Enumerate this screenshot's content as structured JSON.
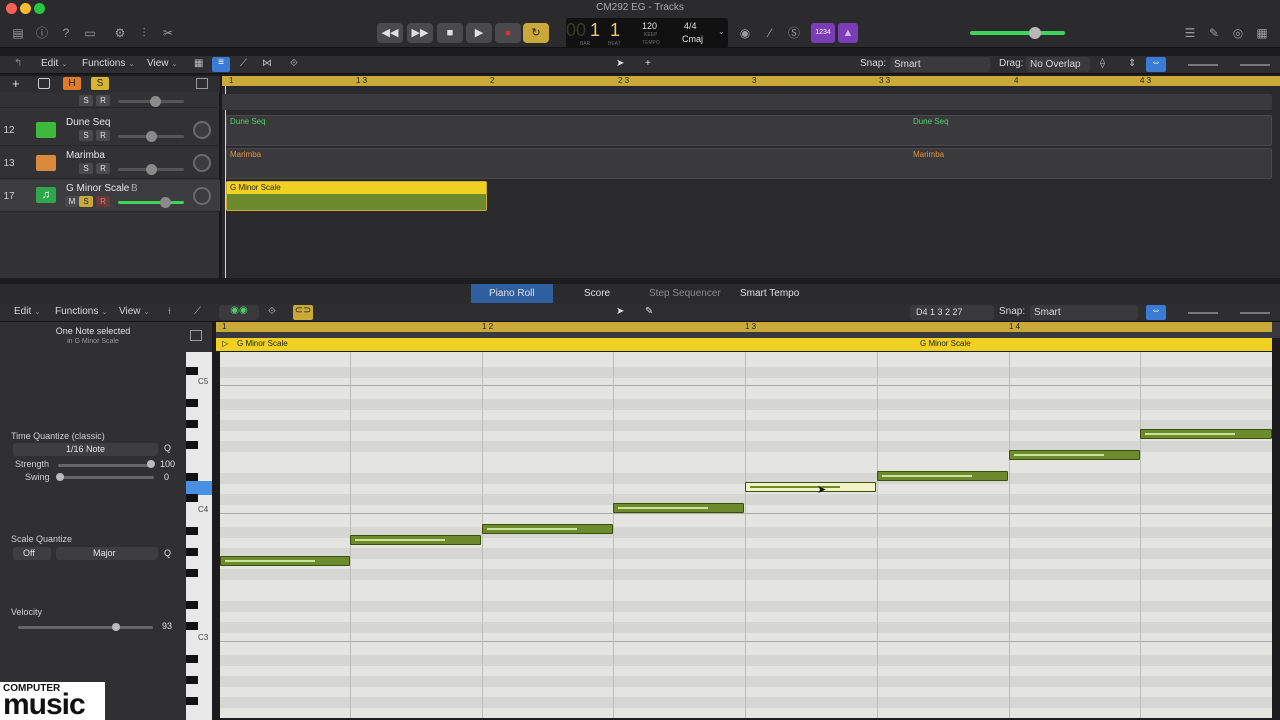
{
  "window": {
    "title": "CM292 EG - Tracks"
  },
  "transport": {
    "bar": "1",
    "beat": "1",
    "bar_prefix": "00",
    "bar_label": "BAR",
    "beat_label": "BEAT",
    "tempo": "120",
    "tempo_sub": "KEEP",
    "tempo_label": "TEMPO",
    "time_signature": "4/4",
    "key": "Cmaj",
    "count_in": "1234"
  },
  "tracks_toolbar": {
    "edit": "Edit",
    "functions": "Functions",
    "view": "View",
    "snap_label": "Snap:",
    "snap_value": "Smart",
    "drag_label": "Drag:",
    "drag_value": "No Overlap",
    "h_button": "H",
    "s_button": "S"
  },
  "ruler": {
    "marks": [
      "1",
      "1 3",
      "2",
      "2 3",
      "3",
      "3 3",
      "4",
      "4 3"
    ]
  },
  "tracks": [
    {
      "num": "12",
      "name": "Dune Seq",
      "color": "#3dba3a"
    },
    {
      "num": "13",
      "name": "Marimba",
      "color": "#d98a3a"
    },
    {
      "num": "17",
      "name": "G Minor Scale",
      "color": "#2fa84c",
      "suffix": "B"
    }
  ],
  "buttons": {
    "mute": "M",
    "solo": "S",
    "rec": "R"
  },
  "regions": {
    "dune1": "Dune Seq",
    "dune2": "Dune Seq",
    "marimba1": "Marimba",
    "marimba2": "Marimba",
    "gminor": "G Minor Scale"
  },
  "pr_tabs": [
    "Piano Roll",
    "Score",
    "Step Sequencer",
    "Smart Tempo"
  ],
  "pr_toolbar": {
    "edit": "Edit",
    "functions": "Functions",
    "view": "View",
    "position": "D4   1 3 2 27",
    "snap_label": "Snap:",
    "snap_value": "Smart"
  },
  "inspector": {
    "selection": "One Note selected",
    "selection_sub": "in G Minor Scale",
    "time_quantize_label": "Time Quantize (classic)",
    "time_quantize_value": "1/16 Note",
    "q": "Q",
    "strength_label": "Strength",
    "strength_value": "100",
    "swing_label": "Swing",
    "swing_value": "0",
    "scale_quantize_label": "Scale Quantize",
    "scale_off": "Off",
    "scale_type": "Major",
    "velocity_label": "Velocity",
    "velocity_value": "93"
  },
  "pr_ruler": {
    "marks": [
      "1",
      "1 2",
      "1 3",
      "1 4"
    ]
  },
  "pr_region": {
    "label1": "G Minor Scale",
    "label2": "G Minor Scale"
  },
  "keyboard": {
    "labels": [
      "C5",
      "C4",
      "C3"
    ]
  },
  "logo": {
    "line1": "COMPUTER",
    "line2": "music"
  }
}
